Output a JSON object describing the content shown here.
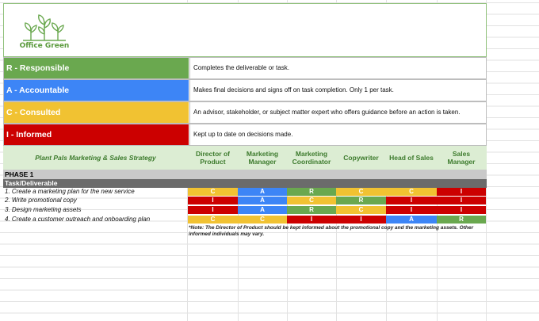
{
  "logo": {
    "text": "Office Green",
    "icon": "sprout-icon",
    "color": "#5a9a3c"
  },
  "legend": [
    {
      "key": "R - Responsible",
      "desc": "Completes the deliverable or task.",
      "color": "#6aa84f"
    },
    {
      "key": "A - Accountable",
      "desc": "Makes final decisions and signs off on task completion. Only 1 per task.",
      "color": "#3d85f6"
    },
    {
      "key": "C - Consulted",
      "desc": "An advisor, stakeholder, or subject matter expert who offers guidance before an action is taken.",
      "color": "#f1c232"
    },
    {
      "key": "I - Informed",
      "desc": "Kept up to date on decisions made.",
      "color": "#cc0000"
    }
  ],
  "header": {
    "title": "Plant Pals Marketing & Sales Strategy",
    "roles": [
      [
        "Director of",
        "Product"
      ],
      [
        "Marketing",
        "Manager"
      ],
      [
        "Marketing",
        "Coordinator"
      ],
      [
        "Copywriter"
      ],
      [
        "Head of Sales"
      ],
      [
        "Sales",
        "Manager"
      ]
    ]
  },
  "phase": "PHASE 1",
  "task_header": "Task/Deliverable",
  "tasks": [
    {
      "label": "1. Create a marketing plan for the new service",
      "cells": [
        "C",
        "A",
        "R",
        "C",
        "C",
        "I"
      ]
    },
    {
      "label": "2. Write promotional copy",
      "cells": [
        "I",
        "A",
        "C",
        "R",
        "I",
        "I"
      ]
    },
    {
      "label": "3. Design marketing assets",
      "cells": [
        "I",
        "A",
        "R",
        "C",
        "I",
        "I"
      ]
    },
    {
      "label": "4. Create a customer outreach and onboarding plan",
      "cells": [
        "C",
        "C",
        "I",
        "I",
        "A",
        "R"
      ]
    }
  ],
  "note": "*Note: The Director of Product should be kept informed about the promotional copy and the marketing assets. Other informed individuals may vary.",
  "colors": {
    "R": "#6aa84f",
    "A": "#3d85f6",
    "C": "#f1c232",
    "I": "#cc0000",
    "header_bg": "#dcedd3",
    "header_text": "#3c7a2c"
  }
}
